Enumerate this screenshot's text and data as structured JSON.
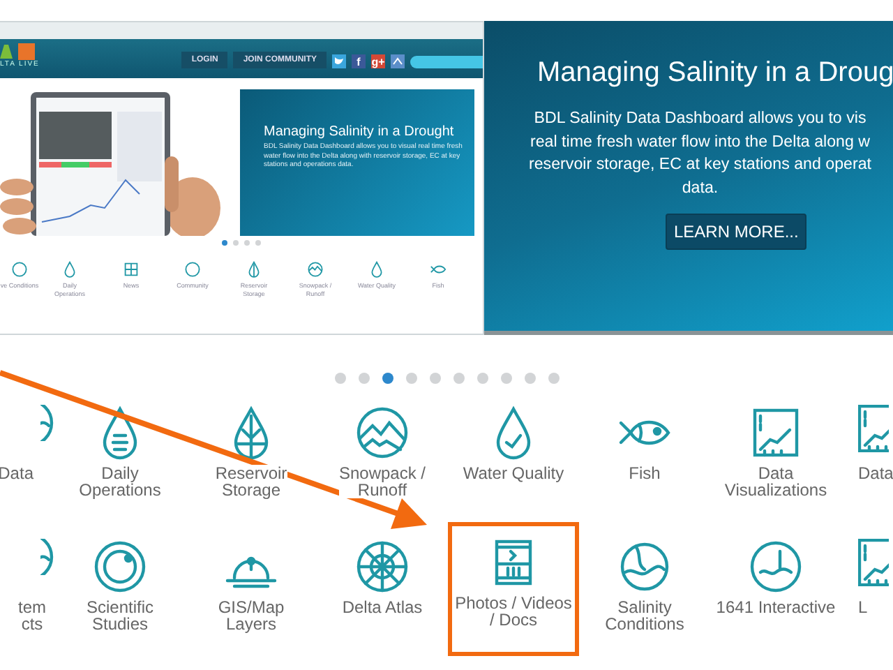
{
  "site_preview": {
    "logo_text": "LTA LIVE",
    "header_buttons": [
      "LOGIN",
      "JOIN COMMUNITY"
    ],
    "social": [
      "f",
      "g+"
    ],
    "slide": {
      "title": "Managing Salinity in a Drought",
      "text": "BDL Salinity Data Dashboard allows you to visual real time fresh water flow into the Delta along with reservoir storage, EC at key stations and operations data."
    },
    "dots": [
      {
        "selected": true
      },
      {
        "selected": false
      },
      {
        "selected": false
      },
      {
        "selected": false
      }
    ],
    "nav": [
      {
        "label": "ve Conditions"
      },
      {
        "label": "Daily\nOperations"
      },
      {
        "label": "News"
      },
      {
        "label": "Community"
      },
      {
        "label": "Reservoir\nStorage"
      },
      {
        "label": "Snowpack /\nRunoff"
      },
      {
        "label": "Water Quality"
      },
      {
        "label": "Fish"
      }
    ]
  },
  "banner": {
    "title": "Managing Salinity in a Droug",
    "text": "BDL Salinity Data Dashboard allows you to vis\nreal time fresh water flow into the Delta along w\nreservoir storage, EC at key stations and operat\ndata.",
    "button": "LEARN MORE..."
  },
  "carousel_dots": [
    {
      "selected": false
    },
    {
      "selected": false
    },
    {
      "selected": true
    },
    {
      "selected": false
    },
    {
      "selected": false
    },
    {
      "selected": false
    },
    {
      "selected": false
    },
    {
      "selected": false
    },
    {
      "selected": false
    },
    {
      "selected": false
    }
  ],
  "grid": [
    [
      {
        "label": "Data",
        "highlighted": false
      },
      {
        "label": "Daily\nOperations",
        "highlighted": false
      },
      {
        "label": "Reservoir\nStorage",
        "highlighted": false
      },
      {
        "label": "Snowpack /\nRunoff",
        "highlighted": false
      },
      {
        "label": "Water Quality",
        "highlighted": false
      },
      {
        "label": "Fish",
        "highlighted": false
      },
      {
        "label": "Data\nVisualizations",
        "highlighted": false
      },
      {
        "label": "Data",
        "highlighted": false
      }
    ],
    [
      {
        "label": "tem\ncts",
        "highlighted": false
      },
      {
        "label": "Scientific\nStudies",
        "highlighted": false
      },
      {
        "label": "GIS/Map\nLayers",
        "highlighted": false
      },
      {
        "label": "Delta Atlas",
        "highlighted": false
      },
      {
        "label": "Photos / Videos\n/ Docs",
        "highlighted": true
      },
      {
        "label": "Salinity\nConditions",
        "highlighted": false
      },
      {
        "label": "1641 Interactive",
        "highlighted": false
      },
      {
        "label": "L",
        "highlighted": false
      }
    ]
  ]
}
